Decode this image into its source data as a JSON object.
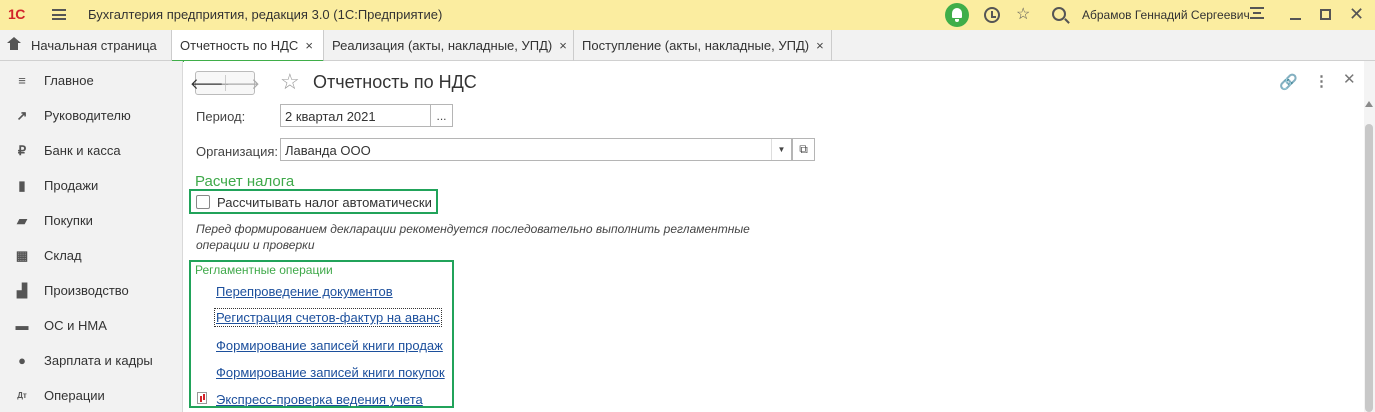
{
  "app": {
    "logo": "1С",
    "title": "Бухгалтерия предприятия, редакция 3.0  (1С:Предприятие)",
    "user": "Абрамов Геннадий Сергеевич"
  },
  "tabs": [
    {
      "label": "Начальная страница"
    },
    {
      "label": "Отчетность по НДС",
      "close": "×"
    },
    {
      "label": "Реализация (акты, накладные, УПД)",
      "close": "×"
    },
    {
      "label": "Поступление (акты, накладные, УПД)",
      "close": "×"
    }
  ],
  "sidebar": {
    "items": [
      {
        "label": "Главное",
        "icon": "≡"
      },
      {
        "label": "Руководителю",
        "icon": "↗"
      },
      {
        "label": "Банк и касса",
        "icon": "₽"
      },
      {
        "label": "Продажи",
        "icon": "▮"
      },
      {
        "label": "Покупки",
        "icon": "▰"
      },
      {
        "label": "Склад",
        "icon": "▦"
      },
      {
        "label": "Производство",
        "icon": "▟"
      },
      {
        "label": "ОС и НМА",
        "icon": "▬"
      },
      {
        "label": "Зарплата и кадры",
        "icon": "●"
      },
      {
        "label": "Операции",
        "icon": "Дт"
      }
    ]
  },
  "doc": {
    "title": "Отчетность по НДС",
    "period_label": "Период:",
    "period_value": "2 квартал 2021",
    "period_btn": "...",
    "org_label": "Организация:",
    "org_value": "Лаванда ООО",
    "tax_section": "Расчет налога",
    "auto_calc_label": "Рассчитывать налог автоматически",
    "hint_line1": "Перед формированием декларации рекомендуется последовательно выполнить регламентные",
    "hint_line2": "операции и проверки",
    "ops_group": "Регламентные операции",
    "ops": [
      "Перепроведение документов",
      "Регистрация счетов-фактур на аванс",
      "Формирование записей книги продаж",
      "Формирование записей книги покупок",
      "Экспресс-проверка ведения учета"
    ]
  },
  "colors": {
    "titlebar": "#fbeda0",
    "accent": "#3fae49",
    "link": "#1c4f9c",
    "highlight_box": "#21a35a"
  }
}
